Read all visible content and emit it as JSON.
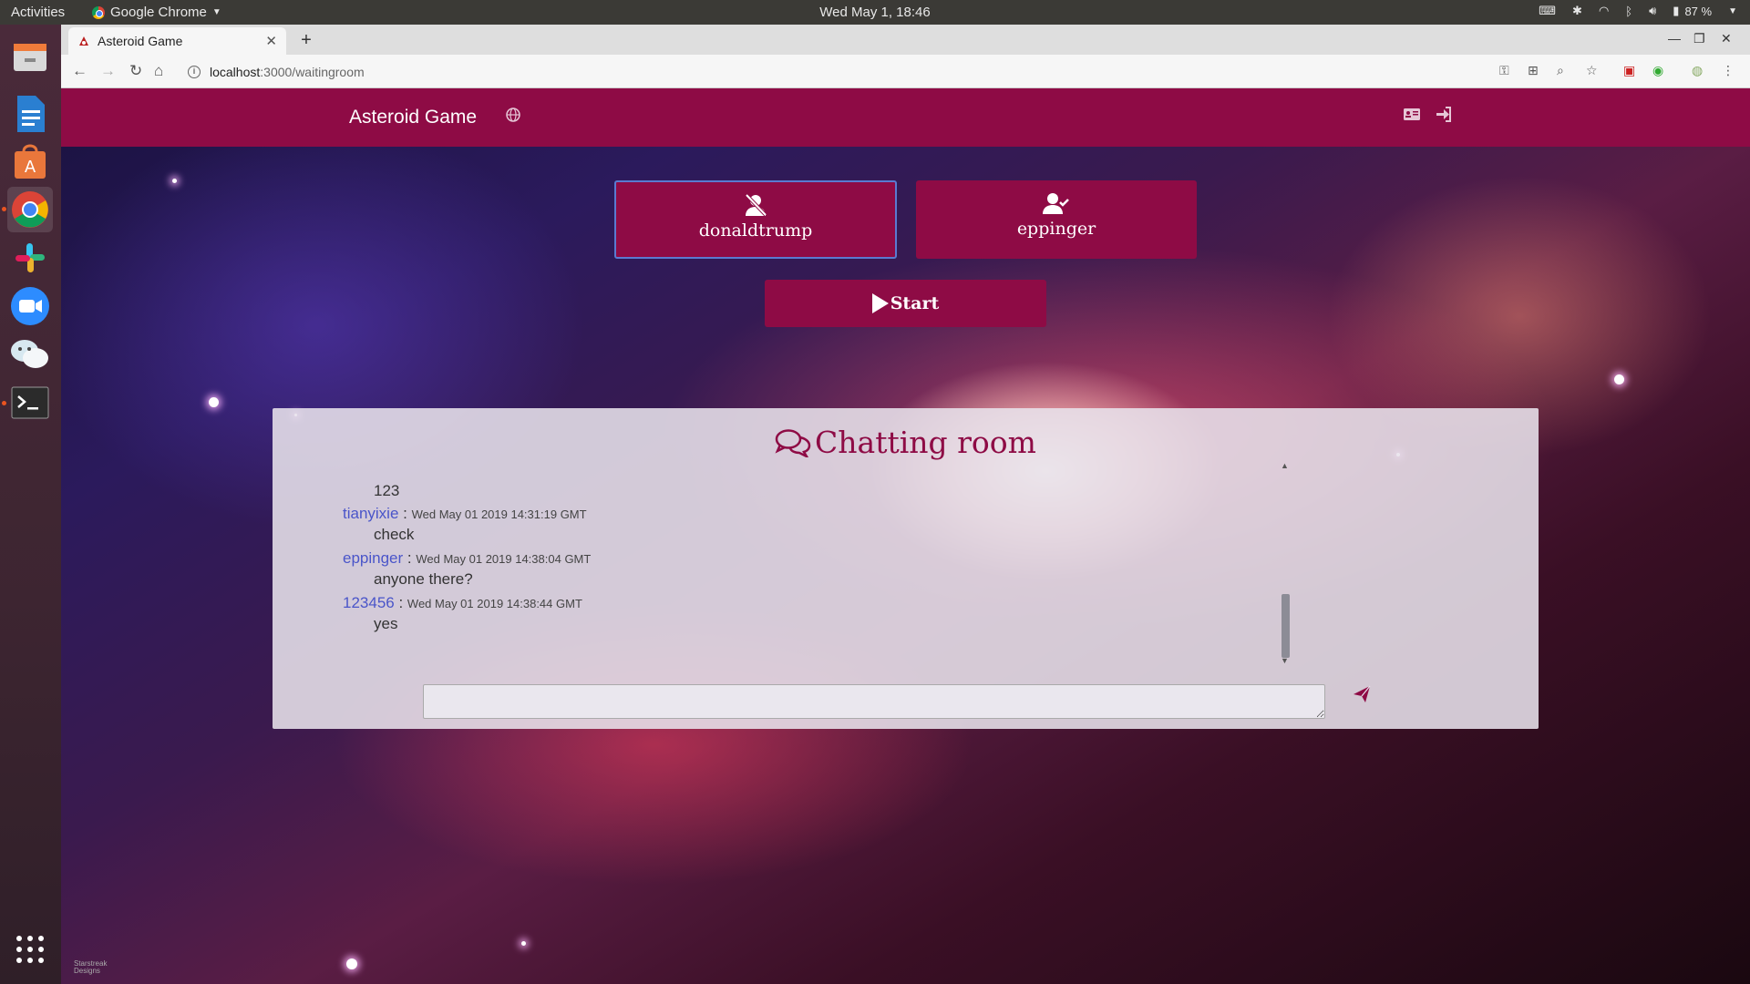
{
  "topbar": {
    "activities": "Activities",
    "app_name": "Google Chrome",
    "clock": "Wed May  1, 18:46",
    "battery": "87 %"
  },
  "browser": {
    "tab_title": "Asteroid Game",
    "url_host": "localhost",
    "url_path": ":3000/waitingroom"
  },
  "navbar": {
    "brand": "Asteroid Game"
  },
  "players": [
    {
      "name": "donaldtrump",
      "status": "not-ready"
    },
    {
      "name": "eppinger",
      "status": "ready"
    }
  ],
  "start_label": "Start",
  "chat": {
    "title": "Chatting room",
    "messages": [
      {
        "user": "",
        "time": "",
        "text": "123"
      },
      {
        "user": "tianyixie",
        "time": "Wed May 01 2019 14:31:19 GMT",
        "text": "check"
      },
      {
        "user": "eppinger",
        "time": "Wed May 01 2019 14:38:04 GMT",
        "text": "anyone there?"
      },
      {
        "user": "123456",
        "time": "Wed May 01 2019 14:38:44 GMT",
        "text": "yes"
      }
    ],
    "input_value": "",
    "scroll_position": 0.85
  },
  "colors": {
    "primary": "#8e0b45",
    "username": "#4a55c9"
  },
  "watermark": [
    "Starstreak",
    "Designs"
  ]
}
